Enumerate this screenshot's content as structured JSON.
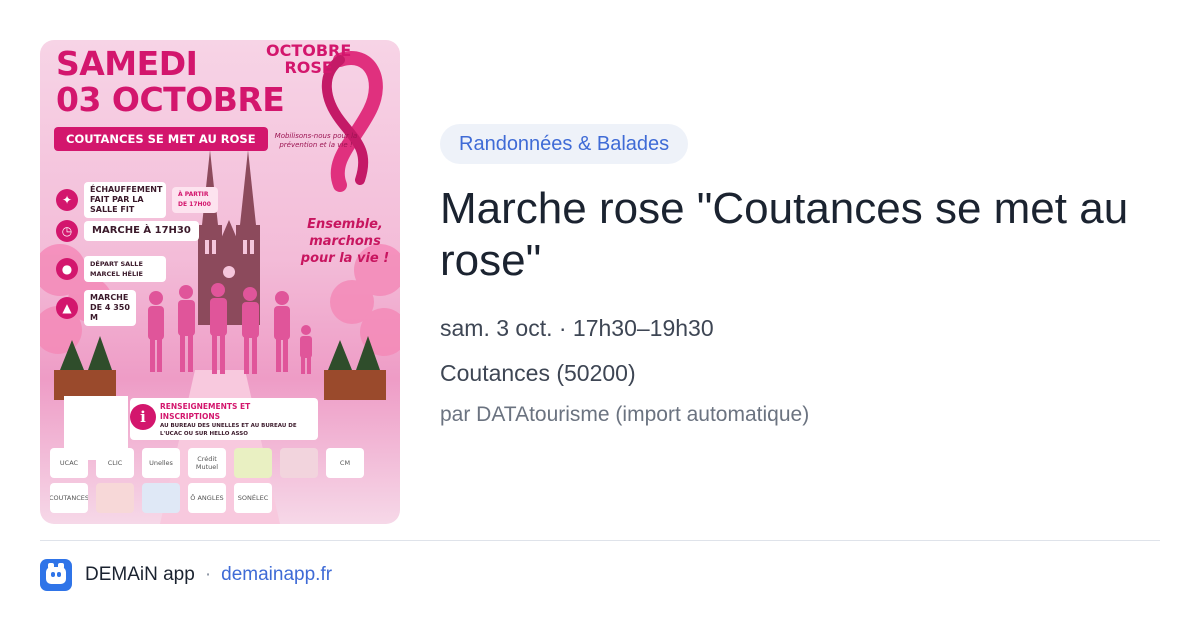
{
  "poster": {
    "day": "SAMEDI",
    "date": "03 OCTOBRE",
    "banner": "COUTANCES SE MET AU ROSE",
    "logo_line1": "OCTOBRE",
    "logo_line2": "ROSE",
    "mobilisons": "Mobilisons-nous pour la prévention et la vie !",
    "ensemble": "Ensemble, marchons pour la vie !",
    "info": [
      {
        "icon": "walker-icon",
        "text": "ÉCHAUFFEMENT FAIT PAR LA SALLE FIT",
        "extra": "À PARTIR DE 17H00"
      },
      {
        "icon": "clock-icon",
        "text": "MARCHE À 17H30"
      },
      {
        "icon": "pin-icon",
        "text": "DÉPART SALLE MARCEL HÉLIE"
      },
      {
        "icon": "shoe-icon",
        "text": "MARCHE DE 4 350 M"
      }
    ],
    "rens_title": "RENSEIGNEMENTS ET INSCRIPTIONS",
    "rens_sub": "AU BUREAU DES UNELLES ET AU BUREAU DE L'UCAC OU SUR HELLO ASSO",
    "sponsors": [
      "UCAC",
      "CLIC",
      "Unelles",
      "Crédit Mutuel",
      "",
      "",
      "CM",
      "COUTANCES",
      "",
      "",
      "Ô ANGLES",
      "SONÉLEC"
    ]
  },
  "category": "Randonnées & Balades",
  "title": "Marche rose \"Coutances se met au rose\"",
  "datetime": "sam. 3 oct. · 17h30–19h30",
  "location": "Coutances (50200)",
  "source": "par DATAtourisme (import automatique)",
  "footer": {
    "app_name": "DEMAiN app",
    "separator": "·",
    "domain": "demainapp.fr"
  },
  "colors": {
    "accent": "#3f6bd6",
    "poster_pink": "#d3166d",
    "chip_bg": "#eef2f9"
  }
}
